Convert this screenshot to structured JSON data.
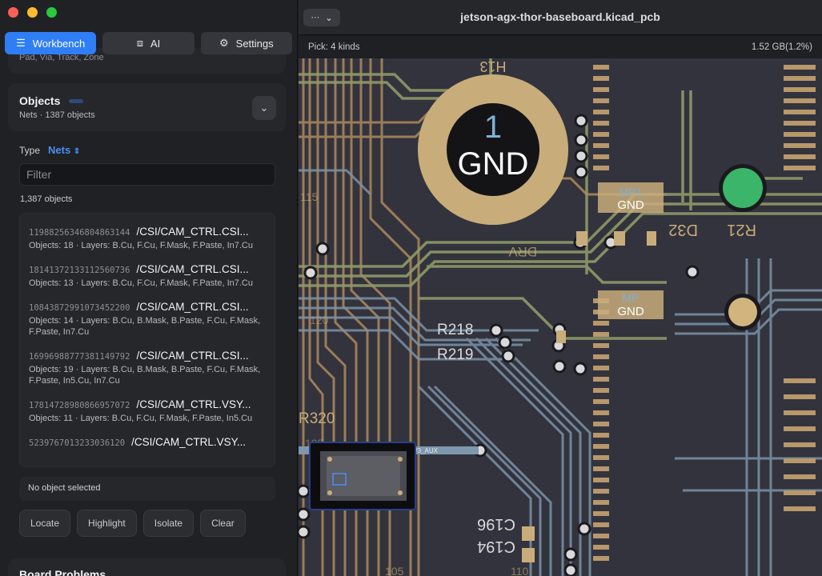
{
  "window": {
    "title": "jetson-agx-thor-baseboard.kicad_pcb",
    "menu_icon": "ellipsis-icon"
  },
  "tabs": [
    {
      "label": "Workbench",
      "icon": "list-icon",
      "active": true
    },
    {
      "label": "AI",
      "icon": "ai-icon",
      "active": false
    },
    {
      "label": "Settings",
      "icon": "gear-icon",
      "active": false
    }
  ],
  "layers_card": {
    "text": "Pad, Via, Track, Zone"
  },
  "objects": {
    "title": "Objects",
    "subtitle": "Nets · 1387 objects",
    "type_label": "Type",
    "type_value": "Nets",
    "filter_placeholder": "Filter",
    "count": "1,387 objects",
    "items": [
      {
        "id": "11988256346804863144",
        "name": "/CSI/CAM_CTRL.CSI...",
        "meta": "Objects: 18 · Layers: B.Cu, F.Cu, F.Mask, F.Paste, In7.Cu"
      },
      {
        "id": "18141372133112560736",
        "name": "/CSI/CAM_CTRL.CSI...",
        "meta": "Objects: 13 · Layers: B.Cu, F.Cu, F.Mask, F.Paste, In7.Cu"
      },
      {
        "id": "10843872991073452200",
        "name": "/CSI/CAM_CTRL.CSI...",
        "meta": "Objects: 14 · Layers: B.Cu, B.Mask, B.Paste, F.Cu, F.Mask, F.Paste, In7.Cu"
      },
      {
        "id": "16996988777381149792",
        "name": "/CSI/CAM_CTRL.CSI...",
        "meta": "Objects: 19 · Layers: B.Cu, B.Mask, B.Paste, F.Cu, F.Mask, F.Paste, In5.Cu, In7.Cu"
      },
      {
        "id": "17814728980866957072",
        "name": "/CSI/CAM_CTRL.VSY...",
        "meta": "Objects: 11 · Layers: B.Cu, F.Cu, F.Mask, F.Paste, In5.Cu"
      },
      {
        "id": "5239767013233036120",
        "name": "/CSI/CAM_CTRL.VSY...",
        "meta": ""
      }
    ],
    "no_selection": "No object selected",
    "actions": [
      "Locate",
      "Highlight",
      "Isolate",
      "Clear"
    ]
  },
  "board_problems": {
    "title": "Board Problems"
  },
  "status": {
    "pick": "Pick: 4 kinds",
    "memory": "1.52 GB(1.2%)"
  },
  "pcb": {
    "colors": {
      "board": "#33333d",
      "copper_orange": "#b08a5e",
      "copper_green": "#8e9b6a",
      "copper_blue": "#7b93a8",
      "pad": "#d2b57e"
    },
    "labels": [
      "H13",
      "1",
      "GND",
      "MP1",
      "GND",
      "MP",
      "GND",
      "D32",
      "R21",
      "R218",
      "R219",
      "R320",
      "C196",
      "C194",
      "115",
      "110",
      "105",
      "120",
      "125",
      "DRV",
      "/Expansion connector/+3V3_AUX"
    ]
  }
}
